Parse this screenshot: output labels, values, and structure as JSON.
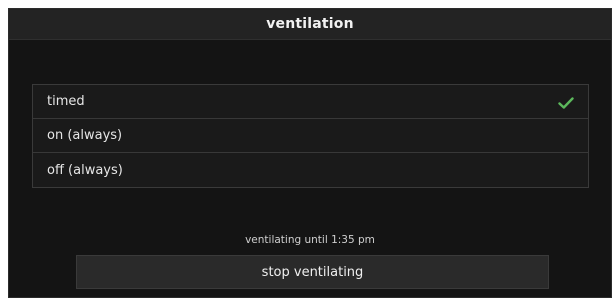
{
  "header": {
    "title": "ventilation"
  },
  "options": [
    {
      "label": "timed",
      "selected": true
    },
    {
      "label": "on (always)",
      "selected": false
    },
    {
      "label": "off (always)",
      "selected": false
    }
  ],
  "icons": {
    "selected_indicator": "check-icon"
  },
  "colors": {
    "check": "#5cb85c"
  },
  "status": {
    "text": "ventilating until 1:35 pm"
  },
  "actions": {
    "stop_label": "stop ventilating"
  }
}
